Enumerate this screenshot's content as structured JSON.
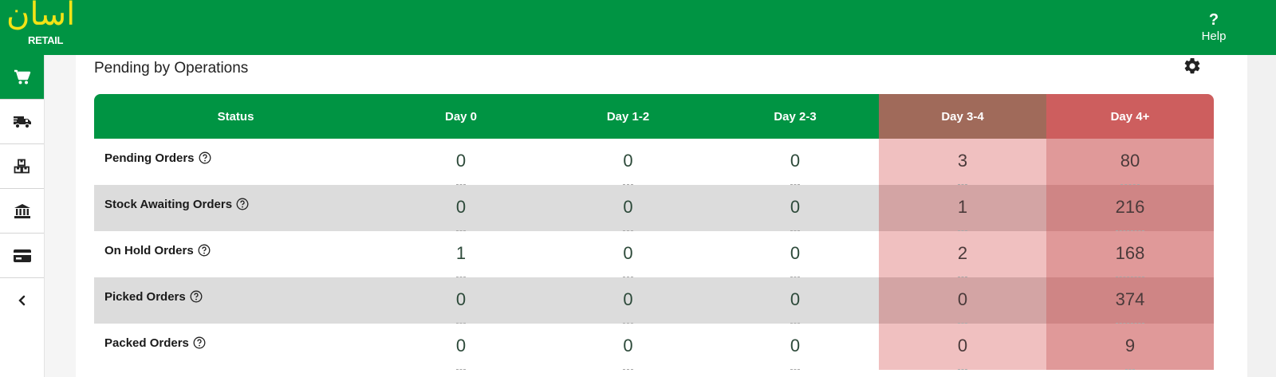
{
  "app": {
    "logo_arabic": "آسان",
    "logo_text": "RETAIL",
    "help_symbol": "?",
    "help_label": "Help"
  },
  "sidebar": {
    "items": [
      {
        "icon": "cart-icon",
        "active": true
      },
      {
        "icon": "truck-icon",
        "active": false
      },
      {
        "icon": "boxes-icon",
        "active": false
      },
      {
        "icon": "bank-icon",
        "active": false
      },
      {
        "icon": "credit-card-icon",
        "active": false
      },
      {
        "icon": "chevron-left-icon",
        "active": false
      }
    ]
  },
  "card": {
    "title": "Pending by Operations",
    "settings_icon": "gear-icon"
  },
  "table": {
    "headers": [
      "Status",
      "Day 0",
      "Day 1-2",
      "Day 2-3",
      "Day 3-4",
      "Day 4+"
    ],
    "rows": [
      {
        "label": "Pending Orders",
        "values": [
          "0",
          "0",
          "0",
          "3",
          "80"
        ]
      },
      {
        "label": "Stock Awaiting Orders",
        "values": [
          "0",
          "0",
          "0",
          "1",
          "216"
        ]
      },
      {
        "label": "On Hold Orders",
        "values": [
          "1",
          "0",
          "0",
          "2",
          "168"
        ]
      },
      {
        "label": "Picked Orders",
        "values": [
          "0",
          "0",
          "0",
          "0",
          "374"
        ]
      },
      {
        "label": "Packed Orders",
        "values": [
          "0",
          "0",
          "0",
          "0",
          "9"
        ]
      }
    ]
  },
  "colors": {
    "brand_green": "#009443",
    "logo_yellow": "#f3e316",
    "day34_header": "#a06a5a",
    "day4plus_header": "#cd5e5e"
  }
}
